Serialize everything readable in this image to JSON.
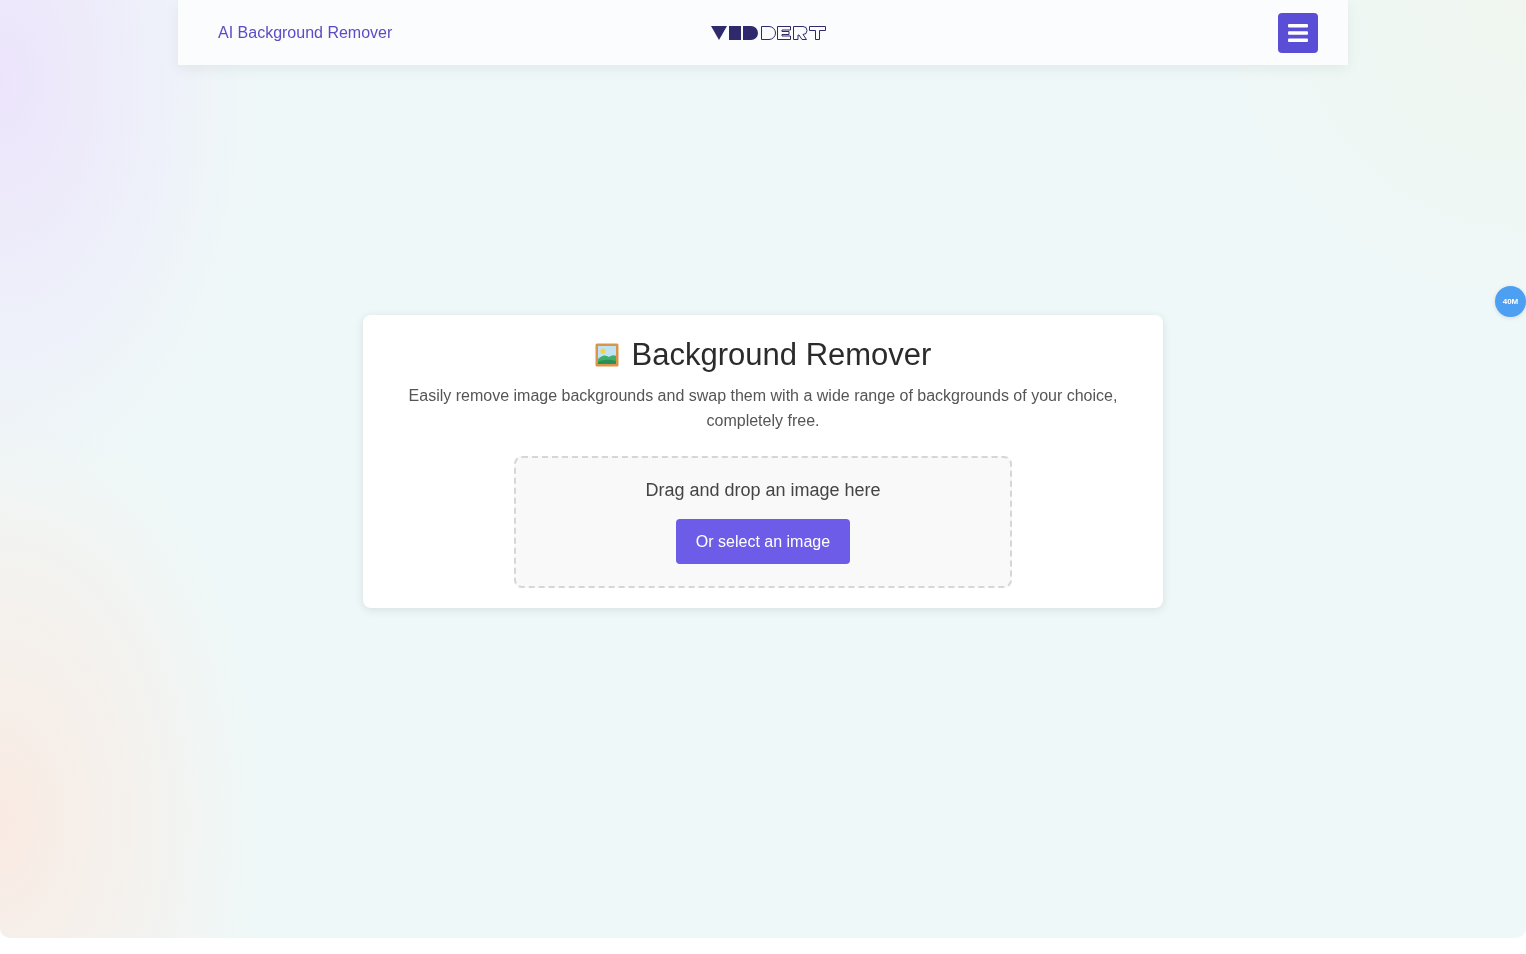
{
  "header": {
    "title": "AI Background Remover"
  },
  "card": {
    "title": "Background Remover",
    "description": "Easily remove image backgrounds and swap them with a wide range of backgrounds of your choice, completely free.",
    "dropzone": {
      "prompt": "Drag and drop an image here",
      "button": "Or select an image"
    }
  },
  "floating_badge": {
    "label": "40M"
  }
}
